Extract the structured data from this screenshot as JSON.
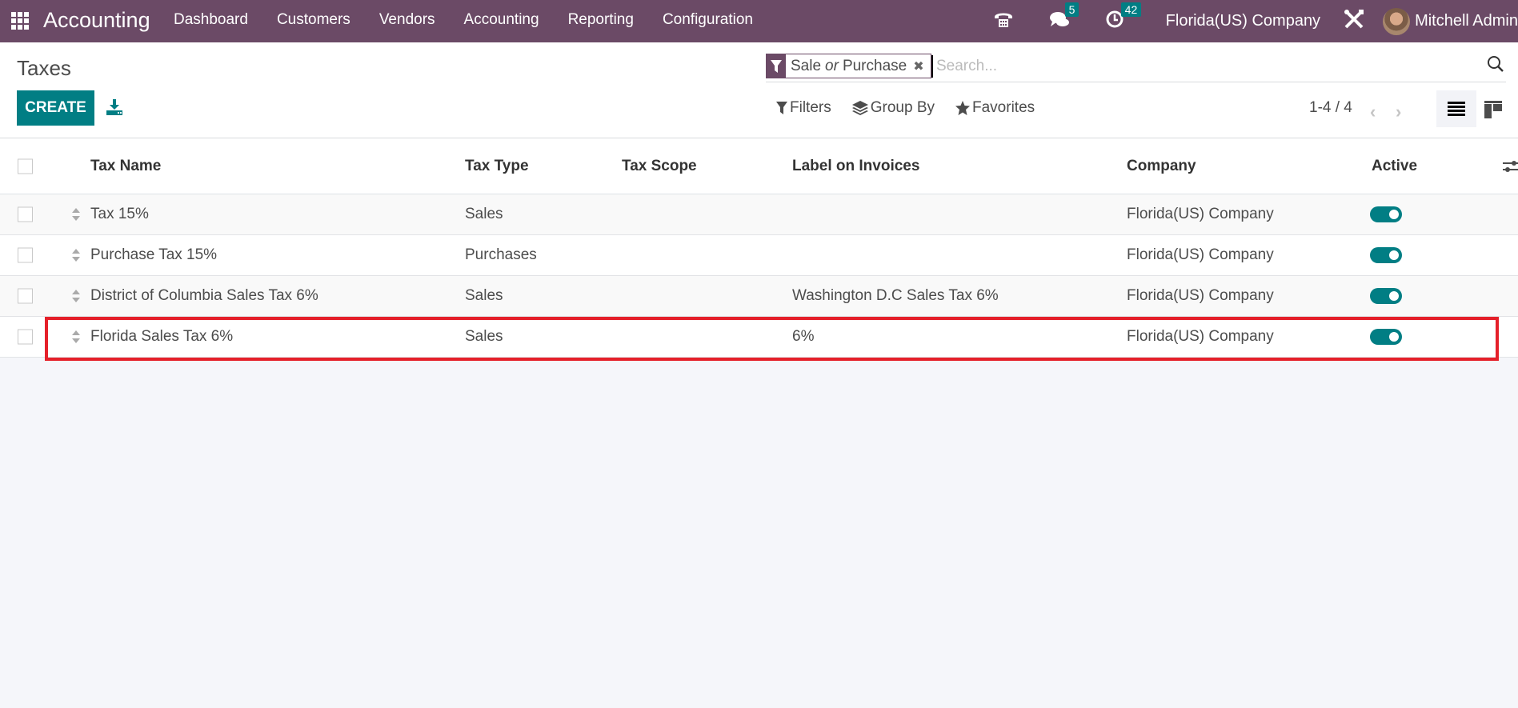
{
  "navbar": {
    "app_name": "Accounting",
    "menu": [
      "Dashboard",
      "Customers",
      "Vendors",
      "Accounting",
      "Reporting",
      "Configuration"
    ],
    "messages_count": "5",
    "activities_count": "42",
    "company": "Florida(US) Company",
    "user": "Mitchell Admin"
  },
  "control_panel": {
    "title": "Taxes",
    "create_label": "CREATE",
    "search": {
      "facet_values": [
        "Sale",
        "Purchase"
      ],
      "facet_separator": "or",
      "placeholder": "Search...",
      "value": ""
    },
    "filters_label": "Filters",
    "group_by_label": "Group By",
    "favorites_label": "Favorites",
    "pager": "1-4 / 4"
  },
  "table": {
    "columns": [
      "Tax Name",
      "Tax Type",
      "Tax Scope",
      "Label on Invoices",
      "Company",
      "Active"
    ],
    "rows": [
      {
        "name": "Tax 15%",
        "type": "Sales",
        "scope": "",
        "label": "",
        "company": "Florida(US) Company",
        "active": true
      },
      {
        "name": "Purchase Tax 15%",
        "type": "Purchases",
        "scope": "",
        "label": "",
        "company": "Florida(US) Company",
        "active": true
      },
      {
        "name": "District of Columbia Sales Tax 6%",
        "type": "Sales",
        "scope": "",
        "label": "Washington D.C Sales Tax 6%",
        "company": "Florida(US) Company",
        "active": true
      },
      {
        "name": "Florida Sales Tax 6%",
        "type": "Sales",
        "scope": "",
        "label": "6%",
        "company": "Florida(US) Company",
        "active": true
      }
    ],
    "highlighted_row": 3
  },
  "colors": {
    "navbar": "#6b4a66",
    "primary": "#017e84",
    "highlight": "#e5202a"
  }
}
